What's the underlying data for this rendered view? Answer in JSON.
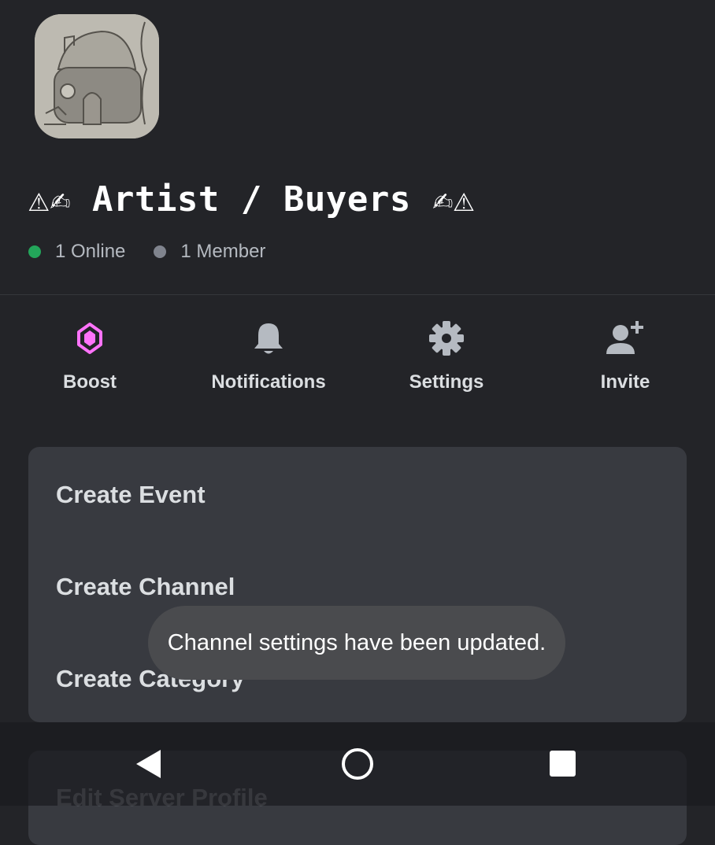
{
  "server": {
    "name": "⚠✍ Artist / Buyers ✍⚠",
    "online": "1 Online",
    "members": "1 Member"
  },
  "colors": {
    "online_dot": "#23a55a",
    "member_dot": "#80848e",
    "boost_icon": "#ff73fa",
    "background": "#232428",
    "card": "#383a40",
    "toast": "#4a4b4e"
  },
  "actions": [
    {
      "label": "Boost",
      "icon": "boost-gem-icon"
    },
    {
      "label": "Notifications",
      "icon": "bell-icon"
    },
    {
      "label": "Settings",
      "icon": "gear-icon"
    },
    {
      "label": "Invite",
      "icon": "add-person-icon"
    }
  ],
  "menu": [
    {
      "label": "Create Event"
    },
    {
      "label": "Create Channel"
    },
    {
      "label": "Create Category"
    }
  ],
  "menu2": [
    {
      "label": "Edit Server Profile"
    }
  ],
  "toast": {
    "message": "Channel settings have been updated."
  },
  "navbar": {
    "buttons": [
      "back-icon",
      "home-icon",
      "recents-icon"
    ]
  }
}
